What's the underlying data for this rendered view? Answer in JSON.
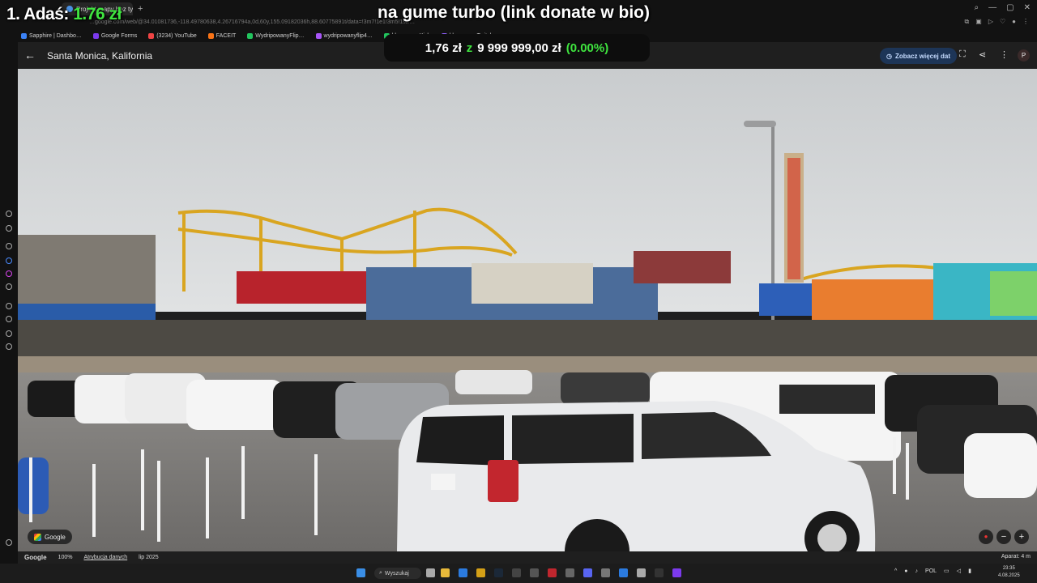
{
  "overlay": {
    "rank_label": "1. Adaś: ",
    "rank_amount": "1.76 zł",
    "donate_text": "na gume turbo (link donate w bio)",
    "goal_current": "1,76 zł",
    "goal_sep": "z",
    "goal_target": "9 999 999,00 zł",
    "goal_pct": "(0.00%)"
  },
  "browser": {
    "tab_title": "Projekt mapy bez tytułu",
    "new_tab": "+",
    "url": "…google.com/web/@34.01081736,-118.49780638,4.26716794a,0d,60y,155.09182036h,88.60775891t/data=!3m7!1e1!3m5!1sZ…",
    "bookmarks": [
      {
        "label": "Sapphire | Dashbo…",
        "color": "#3b82f6"
      },
      {
        "label": "Google Forms",
        "color": "#7c3aed"
      },
      {
        "label": "(3234) YouTube",
        "color": "#ef4444"
      },
      {
        "label": "FACEIT",
        "color": "#f97316"
      },
      {
        "label": "WydripowanyFlip…",
        "color": "#22c55e"
      },
      {
        "label": "wydripowanyflip4…",
        "color": "#a855f7"
      },
      {
        "label": "klopszan - Kick",
        "color": "#22c55e"
      },
      {
        "label": "klopszan - Twitch",
        "color": "#8b5cf6"
      }
    ]
  },
  "maps": {
    "place_title": "Santa Monica, Kalifornia",
    "see_more": "Zobacz więcej dat",
    "google_chip": "Google",
    "footer_brand": "Google",
    "footer_zoom": "100%",
    "footer_attrib": "Atrybucja danych",
    "footer_date": "lip 2025",
    "footer_scale": "Aparat: 4 m"
  },
  "taskbar": {
    "search_label": "Wyszukaj",
    "lang": "POL",
    "time": "23:35",
    "date": "4.08.2025"
  },
  "colors": {
    "accent_green": "#3fe43f",
    "maps_chip_bg": "#1d3557",
    "sky": "#d2d4d6"
  }
}
